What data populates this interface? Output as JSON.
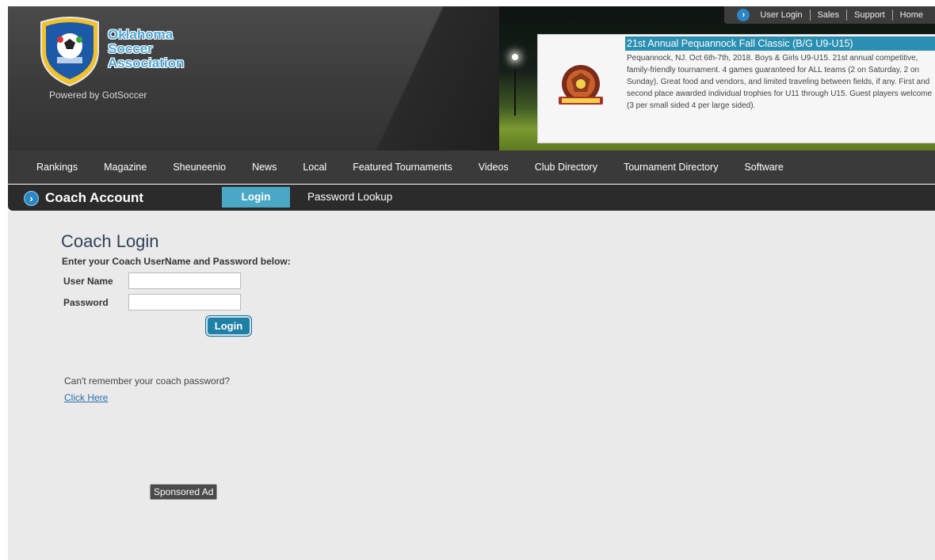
{
  "header": {
    "brand": {
      "line1": "Oklahoma",
      "line2": "Soccer",
      "line3": "Association",
      "powered_by": "Powered by GotSoccer"
    },
    "utility_links": [
      "User Login",
      "Sales",
      "Support",
      "Home"
    ],
    "promo": {
      "title": "21st Annual Pequannock Fall Classic (B/G U9-U15)",
      "description": "Pequannock, NJ. Oct 6th-7th, 2018. Boys & Girls U9-U15. 21st annual competitive, family-friendly tournament. 4 games guaranteed for ALL teams (2 on Saturday, 2 on Sunday). Great food and vendors, and limited traveling between fields, if any. First and second place awarded individual trophies for U11 through U15. Guest players welcome (3 per small sided 4 per large sided)."
    },
    "colors": {
      "brand_blue": "#4ea8d9",
      "promo_title_bg": "#2a8fb0"
    }
  },
  "nav": {
    "items": [
      "Rankings",
      "Magazine",
      "Sheuneenio",
      "News",
      "Local",
      "Featured Tournaments",
      "Videos",
      "Club Directory",
      "Tournament Directory",
      "Software"
    ]
  },
  "coach_bar": {
    "title": "Coach Account",
    "tab_login": "Login",
    "tab_lookup": "Password Lookup"
  },
  "login": {
    "heading": "Coach Login",
    "subheading": "Enter your Coach UserName and Password below:",
    "username_label": "User Name",
    "password_label": "Password",
    "username_value": "",
    "password_value": "",
    "submit_label": "Login",
    "forgot_text": "Can't remember your coach password?",
    "forgot_link": "Click Here"
  },
  "ad": {
    "label": "Sponsored Ad"
  }
}
